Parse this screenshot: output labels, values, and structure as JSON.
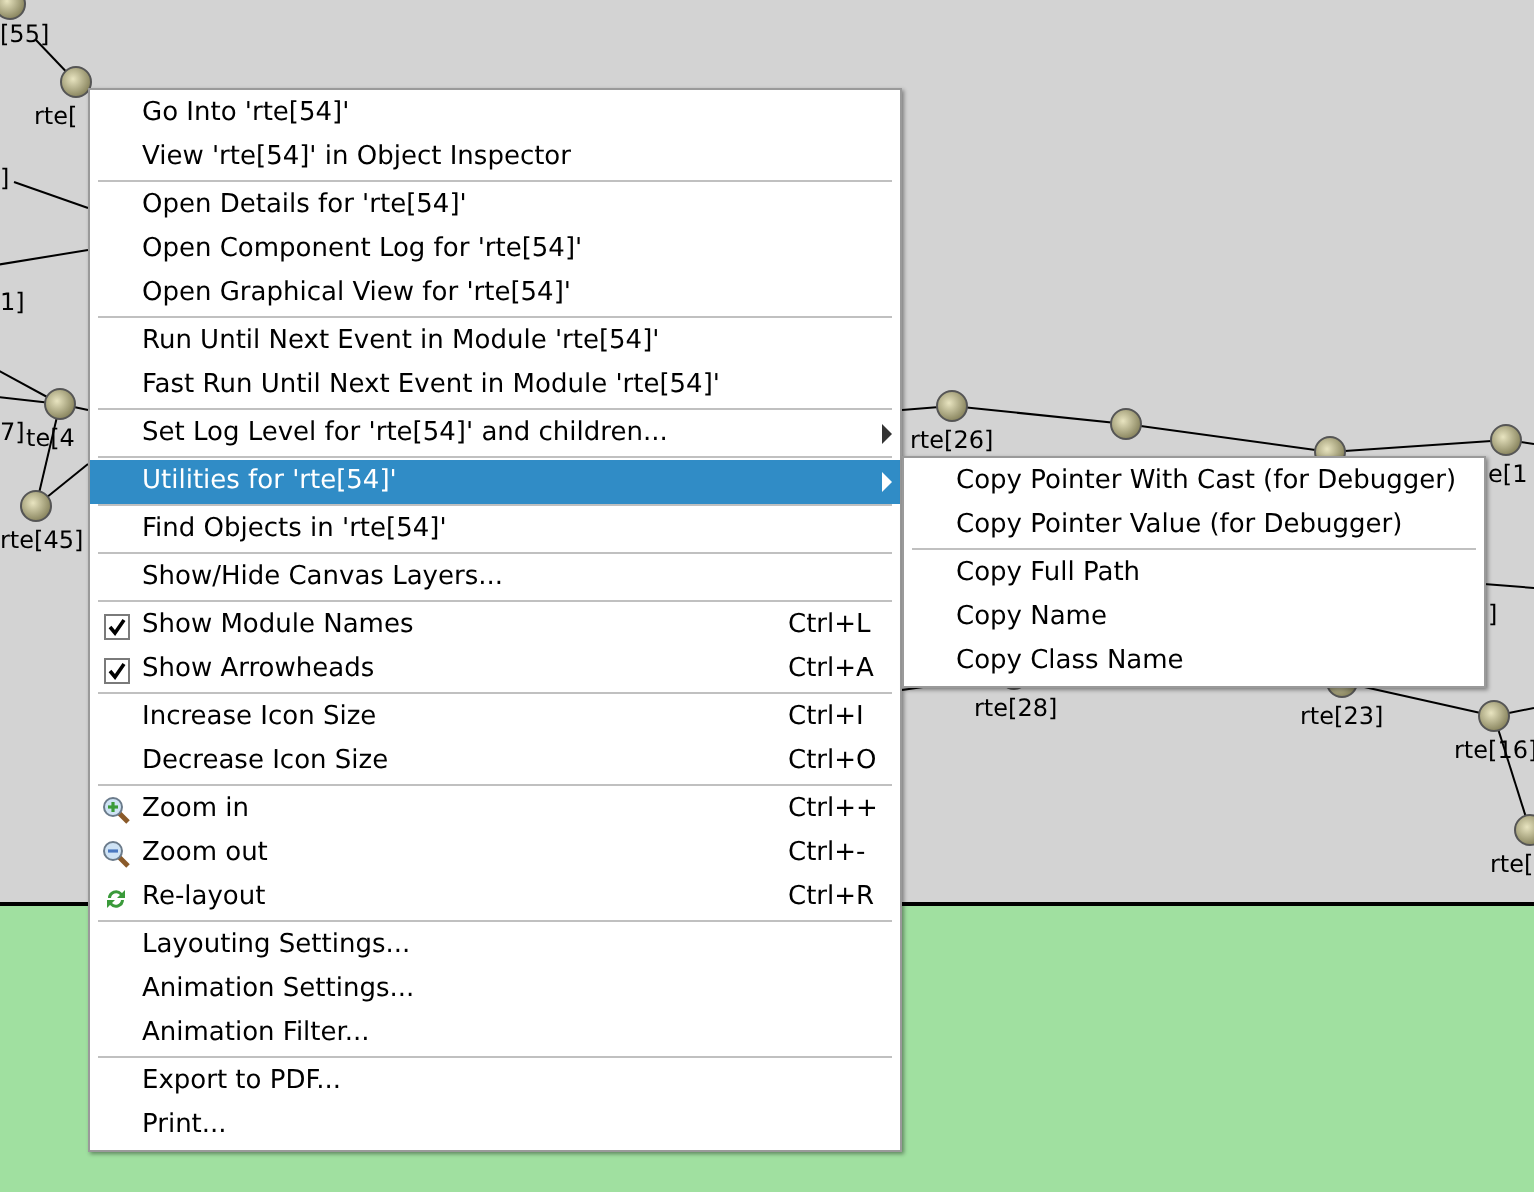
{
  "canvas": {
    "labels": [
      "[55]",
      "rte[",
      "]",
      "1]",
      "7]",
      "te[4",
      "rte[45]",
      "rte[26]",
      "e[1",
      "]",
      "rte[28]",
      "rte[23]",
      "rte[16]",
      "rte["
    ]
  },
  "context_menu": {
    "items": [
      {
        "kind": "item",
        "label": "Go Into 'rte[54]'"
      },
      {
        "kind": "item",
        "label": "View 'rte[54]' in Object Inspector"
      },
      {
        "kind": "separator"
      },
      {
        "kind": "item",
        "label": "Open Details for 'rte[54]'"
      },
      {
        "kind": "item",
        "label": "Open Component Log for 'rte[54]'"
      },
      {
        "kind": "item",
        "label": "Open Graphical View for 'rte[54]'"
      },
      {
        "kind": "separator"
      },
      {
        "kind": "item",
        "label": "Run Until Next Event in Module 'rte[54]'"
      },
      {
        "kind": "item",
        "label": "Fast Run Until Next Event in Module 'rte[54]'"
      },
      {
        "kind": "separator"
      },
      {
        "kind": "submenu",
        "label": "Set Log Level for 'rte[54]' and children...",
        "selected": false
      },
      {
        "kind": "separator"
      },
      {
        "kind": "submenu",
        "label": "Utilities for 'rte[54]'",
        "selected": true
      },
      {
        "kind": "separator"
      },
      {
        "kind": "item",
        "label": "Find Objects in 'rte[54]'"
      },
      {
        "kind": "separator"
      },
      {
        "kind": "item",
        "label": "Show/Hide Canvas Layers..."
      },
      {
        "kind": "separator"
      },
      {
        "kind": "checkbox",
        "label": "Show Module Names",
        "shortcut": "Ctrl+L",
        "checked": true
      },
      {
        "kind": "checkbox",
        "label": "Show Arrowheads",
        "shortcut": "Ctrl+A",
        "checked": true
      },
      {
        "kind": "separator"
      },
      {
        "kind": "item",
        "label": "Increase Icon Size",
        "shortcut": "Ctrl+I"
      },
      {
        "kind": "item",
        "label": "Decrease Icon Size",
        "shortcut": "Ctrl+O"
      },
      {
        "kind": "separator"
      },
      {
        "kind": "zoom-in",
        "label": "Zoom in",
        "shortcut": "Ctrl++"
      },
      {
        "kind": "zoom-out",
        "label": "Zoom out",
        "shortcut": "Ctrl+-"
      },
      {
        "kind": "relayout",
        "label": "Re-layout",
        "shortcut": "Ctrl+R"
      },
      {
        "kind": "separator"
      },
      {
        "kind": "item",
        "label": "Layouting Settings..."
      },
      {
        "kind": "item",
        "label": "Animation Settings..."
      },
      {
        "kind": "item",
        "label": "Animation Filter..."
      },
      {
        "kind": "separator"
      },
      {
        "kind": "item",
        "label": "Export to PDF..."
      },
      {
        "kind": "item",
        "label": "Print..."
      }
    ]
  },
  "submenu": {
    "items": [
      {
        "kind": "item",
        "label": "Copy Pointer With Cast (for Debugger)"
      },
      {
        "kind": "item",
        "label": "Copy Pointer Value (for Debugger)"
      },
      {
        "kind": "separator"
      },
      {
        "kind": "item",
        "label": "Copy Full Path"
      },
      {
        "kind": "item",
        "label": "Copy Name"
      },
      {
        "kind": "item",
        "label": "Copy Class Name"
      }
    ]
  }
}
